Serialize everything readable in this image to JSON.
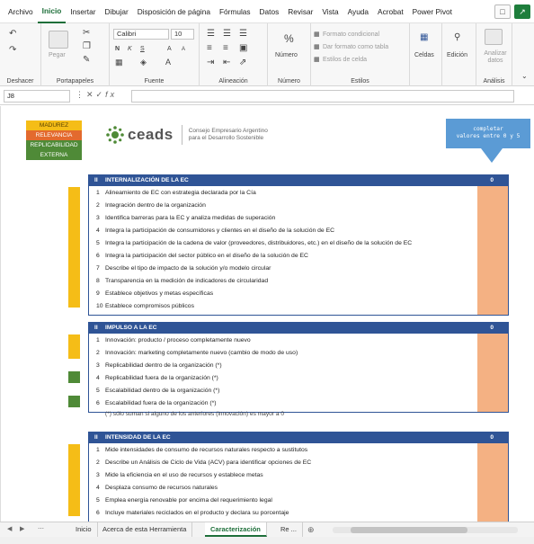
{
  "menu": {
    "items": [
      "Archivo",
      "Inicio",
      "Insertar",
      "Dibujar",
      "Disposición de página",
      "Fórmulas",
      "Datos",
      "Revisar",
      "Vista",
      "Ayuda",
      "Acrobat",
      "Power Pivot"
    ],
    "active_index": 1
  },
  "ribbon": {
    "undo_label": "Deshacer",
    "paste_label": "Pegar",
    "clipboard_label": "Portapapeles",
    "font_name": "Calibri",
    "font_size": "10",
    "font_group_label": "Fuente",
    "alignment_label": "Alineación",
    "number_label": "Número",
    "number_symbol": "%",
    "conditional_format": "Formato condicional",
    "format_as_table": "Dar formato como tabla",
    "cell_styles": "Estilos de celda",
    "styles_label": "Estilos",
    "cells_label": "Celdas",
    "editing_label": "Edición",
    "analyze_label": "Analizar datos",
    "analysis_label": "Análisis",
    "bold": "N",
    "italic": "K",
    "underline": "S",
    "grow_font": "A",
    "shrink_font": "A"
  },
  "formula_bar": {
    "name_box": "J8",
    "fx": "fx",
    "value": ""
  },
  "legend": [
    "MADUREZ",
    "RELEVANCIA",
    "REPLICABILIDAD",
    "EXTERNA"
  ],
  "logo": {
    "word": "ceads",
    "tagline_1": "Consejo Empresario Argentino",
    "tagline_2": "para el Desarrollo Sostenible"
  },
  "callout": {
    "line1": "completar",
    "line2": "valores entre 0 y 5"
  },
  "sections": [
    {
      "num": "II",
      "title": "INTERNALIZACIÓN DE LA EC",
      "score": "0",
      "rows": [
        {
          "n": "1",
          "text": "Alineamiento de EC con estrategia declarada por la Cía"
        },
        {
          "n": "2",
          "text": "Integración dentro de la organización"
        },
        {
          "n": "3",
          "text": "Identifica barreras para la EC y analiza medidas de superación"
        },
        {
          "n": "4",
          "text": "Integra la participación de consumidores y clientes en el diseño de la solución de EC"
        },
        {
          "n": "5",
          "text": "Integra la participación de la cadena de valor (proveedores, distribuidores, etc.) en el diseño de la solución de EC"
        },
        {
          "n": "6",
          "text": "Integra la participación del sector público en el diseño de la solución de EC"
        },
        {
          "n": "7",
          "text": "Describe el tipo de impacto de la solución y/o modelo circular"
        },
        {
          "n": "8",
          "text": "Transparencia en la medición de indicadores de circularidad"
        },
        {
          "n": "9",
          "text": "Establece objetivos y metas específicas"
        },
        {
          "n": "10",
          "text": "Establece compromisos públicos"
        }
      ]
    },
    {
      "num": "II",
      "title": "IMPULSO A LA EC",
      "score": "0",
      "rows": [
        {
          "n": "1",
          "text": "Innovación: producto / proceso completamente nuevo"
        },
        {
          "n": "2",
          "text": "Innovación: marketing completamente nuevo (cambio de modo de uso)"
        },
        {
          "n": "3",
          "text": "Replicabilidad dentro de la organización (*)"
        },
        {
          "n": "4",
          "text": "Replicabilidad fuera de la organización (*)"
        },
        {
          "n": "5",
          "text": "Escalabilidad dentro de la organización (*)"
        },
        {
          "n": "6",
          "text": "Escalabilidad fuera de la organización (*)"
        }
      ]
    },
    {
      "num": "II",
      "title": "INTENSIDAD DE LA EC",
      "score": "0",
      "rows": [
        {
          "n": "1",
          "text": "Mide intensidades de consumo de recursos naturales respecto a sustitutos"
        },
        {
          "n": "2",
          "text": "Describe un Análisis de Ciclo de Vida (ACV)  para identificar opciones de EC"
        },
        {
          "n": "3",
          "text": "Mide la eficiencia en el uso de recursos y establece metas"
        },
        {
          "n": "4",
          "text": "Desplaza consumo de recursos naturales"
        },
        {
          "n": "5",
          "text": "Emplea energía renovable por encima del requerimiento legal"
        },
        {
          "n": "6",
          "text": "Incluye materiales reciclados en el producto y declara su porcentaje"
        }
      ]
    }
  ],
  "footnote": "(*) sólo suman si alguno de los anteriores (innovación) es mayor a 0",
  "tabs": {
    "items": [
      "Inicio",
      "Acerca de esta Herramienta",
      "Caracterización",
      "Re ..."
    ],
    "active_index": 2
  },
  "colors": {
    "header_blue": "#2f5496",
    "peach": "#f4b183",
    "yellow": "#f5bd17",
    "orange": "#e36a2e",
    "green": "#4f8a37",
    "callout_blue": "#5b9bd5",
    "excel_green": "#1e6f3a"
  }
}
